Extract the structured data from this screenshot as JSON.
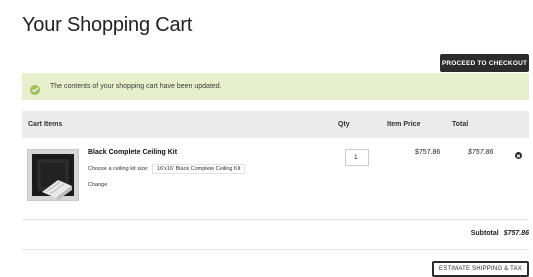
{
  "page": {
    "title": "Your Shopping Cart"
  },
  "actions": {
    "proceed_checkout_label": "PROCEED TO CHECKOUT",
    "estimate_label": "ESTIMATE SHIPPING & TAX"
  },
  "notice": {
    "icon": "check-circle-icon",
    "message": "The contents of your shopping cart have been updated.",
    "background_color": "#e7efcd",
    "icon_color": "#9cc25a"
  },
  "table": {
    "headers": {
      "items": "Cart Items",
      "qty": "Qty",
      "price": "Item Price",
      "total": "Total"
    },
    "rows": [
      {
        "name": "Black Complete Ceiling Kit",
        "option_label": "Choose a ceiling kit size:",
        "option_value": "16'x16' Black Complete Ceiling Kit",
        "change_label": "Change",
        "qty": "1",
        "price": "$757.86",
        "total": "$757.86",
        "remove_icon": "remove-circle-icon"
      }
    ]
  },
  "summary": {
    "subtotal_label": "Subtotal",
    "subtotal_value": "$757.86"
  },
  "colors": {
    "dark_button": "#2b2b2b",
    "header_bg": "#ebebeb"
  }
}
